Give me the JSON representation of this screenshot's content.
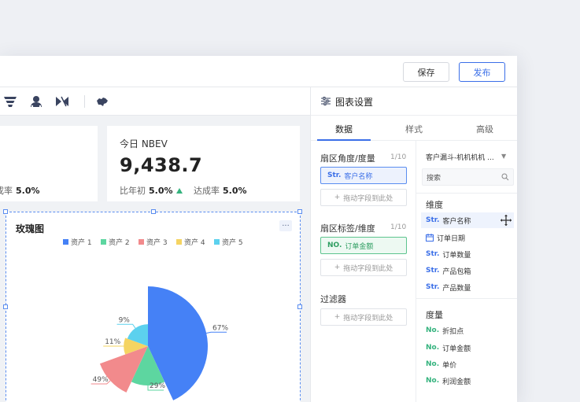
{
  "topbar": {
    "save_label": "保存",
    "publish_label": "发布"
  },
  "kpi_left": {
    "sub_label": "成率",
    "sub_value": "5.0%"
  },
  "kpi_main": {
    "title": "今日 NBEV",
    "value": "9,438.7",
    "yoy_label": "比年初",
    "yoy_value": "5.0%",
    "rate_label": "达成率",
    "rate_value": "5.0%"
  },
  "chart_data": {
    "type": "pie",
    "subtype": "rose",
    "title": "玫瑰图",
    "legend_position": "top",
    "series": [
      {
        "name": "资产 1",
        "value": 67,
        "color": "#4581f6"
      },
      {
        "name": "资产 2",
        "value": 29,
        "color": "#5dd6a0"
      },
      {
        "name": "资产 3",
        "value": 49,
        "color": "#f28a8c"
      },
      {
        "name": "资产 4",
        "value": 11,
        "color": "#f5d462"
      },
      {
        "name": "资产 5",
        "value": 9,
        "color": "#5cd1ee"
      }
    ],
    "labels": [
      "67%",
      "29%",
      "49%",
      "11%",
      "9%"
    ]
  },
  "chart_card": {
    "more_label": "..."
  },
  "settings": {
    "title": "图表设置",
    "tabs": [
      "数据",
      "样式",
      "高级"
    ],
    "sections": {
      "angle": {
        "label": "扇区角度/度量",
        "count": "1/10",
        "field_tag": "Str.",
        "field_name": "客户名称"
      },
      "tag": {
        "label": "扇区标签/维度",
        "count": "1/10",
        "field_tag": "NO.",
        "field_name": "订单金额"
      },
      "filter": {
        "label": "过滤器"
      },
      "drop_hint": "拖动字段到此处"
    },
    "dataset": "客户漏斗-机机机机 ...",
    "search_placeholder": "搜索",
    "dimension_label": "维度",
    "dimensions": [
      {
        "tag": "Str.",
        "name": "客户名称"
      },
      {
        "tag": "",
        "name": "订单日期"
      },
      {
        "tag": "Str.",
        "name": "订单数量"
      },
      {
        "tag": "Str.",
        "name": "产品包箱"
      },
      {
        "tag": "Str.",
        "name": "产品数量"
      }
    ],
    "measure_label": "度量",
    "measures": [
      {
        "tag": "No.",
        "name": "折扣点"
      },
      {
        "tag": "No.",
        "name": "订单金额"
      },
      {
        "tag": "No.",
        "name": "单价"
      },
      {
        "tag": "No.",
        "name": "利润金额"
      }
    ]
  }
}
